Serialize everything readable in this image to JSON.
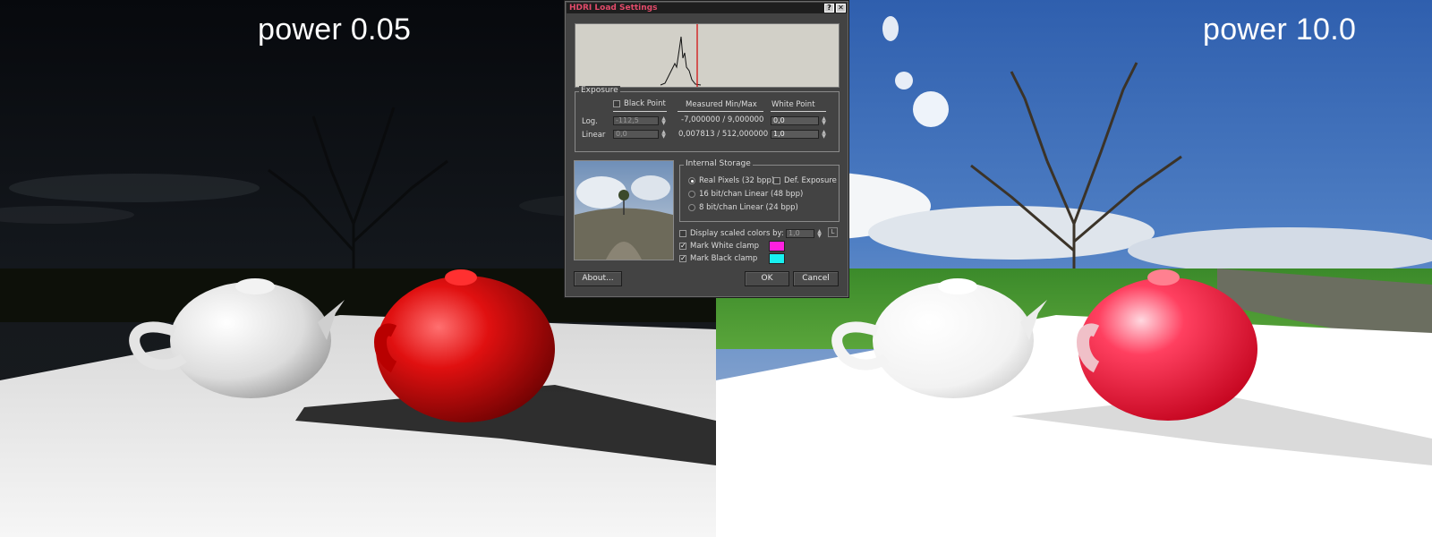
{
  "left_panel": {
    "caption": "power 0.05"
  },
  "right_panel": {
    "caption": "power 10.0"
  },
  "dialog": {
    "title": "HDRI Load Settings",
    "help_glyph": "?",
    "close_glyph": "✕",
    "exposure": {
      "group_label": "Exposure",
      "black_point_label": "Black Point",
      "black_point_checked": false,
      "measured_header": "Measured Min/Max",
      "white_point_header": "White Point",
      "log_label": "Log.",
      "linear_label": "Linear",
      "black_log_value": "-112,5",
      "black_linear_value": "0,0",
      "measured_log": "-7,000000 / 9,000000",
      "measured_linear": "0,007813 / 512,000000",
      "white_log_value": "0,0",
      "white_linear_value": "1,0"
    },
    "storage": {
      "group_label": "Internal Storage",
      "option_32": "Real Pixels (32 bpp)",
      "option_48": "16 bit/chan Linear (48 bpp)",
      "option_24": "8 bit/chan Linear (24 bpp)",
      "selected": "Real Pixels (32 bpp)",
      "def_exposure_label": "Def. Exposure",
      "def_exposure_checked": false
    },
    "display_scaled_label": "Display scaled colors by:",
    "display_scaled_checked": false,
    "display_scaled_value": "1,0",
    "lock_glyph": "L",
    "mark_white_label": "Mark White clamp",
    "mark_white_checked": true,
    "mark_white_color": "#ff20e0",
    "mark_black_label": "Mark Black clamp",
    "mark_black_checked": true,
    "mark_black_color": "#18f0f0",
    "about_label": "About...",
    "ok_label": "OK",
    "cancel_label": "Cancel",
    "colors": {
      "title_text": "#e34b6a",
      "histogram_marker": "#d21f1f"
    }
  }
}
